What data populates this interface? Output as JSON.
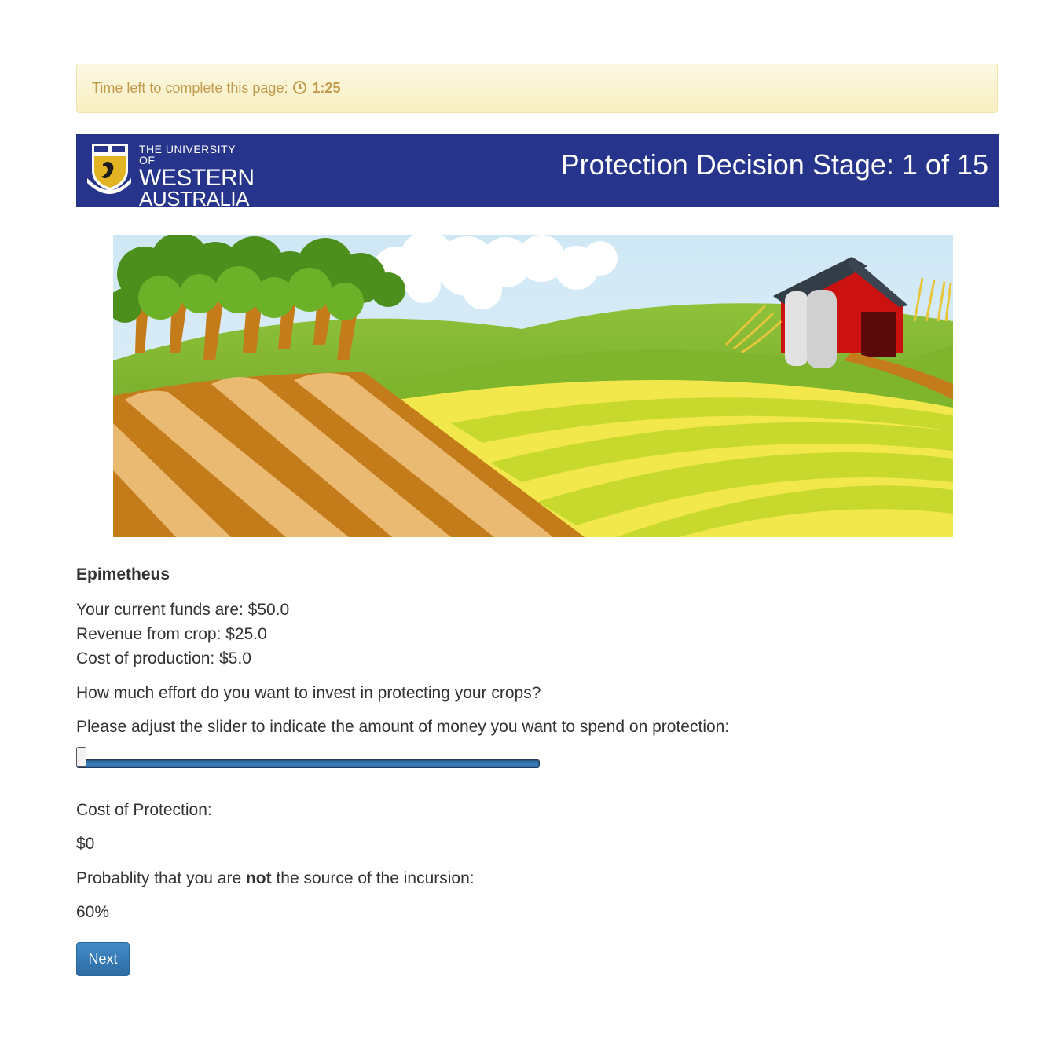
{
  "timer": {
    "label": "Time left to complete this page:",
    "icon": "clock-icon",
    "value": "1:25"
  },
  "header": {
    "logo": {
      "line1": "THE UNIVERSITY OF",
      "line2": "WESTERN",
      "line3": "AUSTRALIA"
    },
    "title": "Protection Decision Stage: 1 of 15",
    "background_color": "#27348b"
  },
  "banner_image": {
    "description_icon": "farm-landscape-illustration"
  },
  "main": {
    "player_name": "Epimetheus",
    "funds": "Your current funds are: $50.0",
    "revenue": "Revenue from crop: $25.0",
    "cost_production": "Cost of production: $5.0",
    "question": "How much effort do you want to invest in protecting your crops?",
    "slider_instruction": "Please adjust the slider to indicate the amount of money you want to spend on protection:",
    "slider_value_fraction": 0,
    "cost_protection_label": "Cost of Protection:",
    "cost_protection_value": "$0",
    "probability_prefix": "Probablity that you are ",
    "probability_bold": "not",
    "probability_suffix": " the source of the incursion:",
    "probability_value": "60%",
    "next_label": "Next"
  }
}
